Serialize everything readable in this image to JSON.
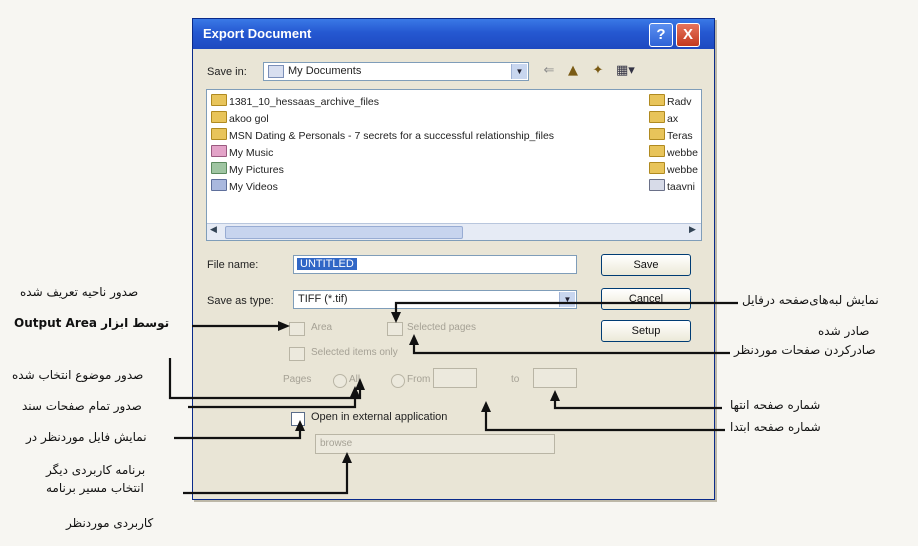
{
  "dialog": {
    "title": "Export Document",
    "help_label": "?",
    "close_label": "X",
    "save_in_label": "Save in:",
    "save_in_value": "My Documents",
    "files_left": [
      "1381_10_hessaas_archive_files",
      "akoo gol",
      "MSN Dating & Personals - 7 secrets for a successful relationship_files",
      "My Music",
      "My Pictures",
      "My Videos"
    ],
    "files_right": [
      "Radv",
      "ax",
      "Teras",
      "webbe",
      "webbe",
      "taavni"
    ],
    "file_name_label": "File name:",
    "file_name_value": "UNTITLED",
    "save_as_type_label": "Save as type:",
    "save_as_type_value": "TIFF (*.tif)",
    "save_button": "Save",
    "cancel_button": "Cancel",
    "setup_button": "Setup",
    "opt_area": "Area",
    "opt_selected_page": "Selected pages",
    "opt_selected_items": "Selected items only",
    "opt_pages": "Pages",
    "opt_all": "All",
    "opt_from": "From",
    "opt_to": "to",
    "open_external": "Open in external application",
    "app_path": "browse"
  },
  "annotations": {
    "l1": "صدور ناحیه تعریف شده",
    "l2": "توسط ابزار Output Area",
    "l3": "صدور موضوع انتخاب شده",
    "l4": "صدور تمام صفحات سند",
    "l5": "نمایش فایل موردنظر در",
    "l6": "برنامه کاربردی دیگر",
    "l7": "انتخاب مسیر برنامه",
    "l8": "کاربردی موردنظر",
    "r1": "نمایش لبه‌های‌صفحه درفایل",
    "r2": "صادر شده",
    "r3": "صادرکردن صفحات موردنظر",
    "r4": "شماره صفحه انتها",
    "r5": "شماره صفحه ابتدا"
  }
}
